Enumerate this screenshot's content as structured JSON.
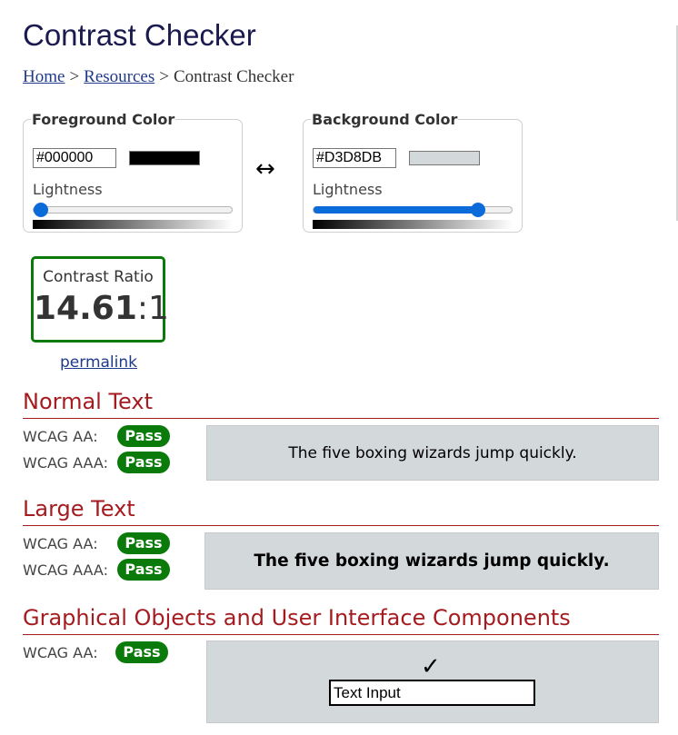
{
  "page_title": "Contrast Checker",
  "breadcrumb": {
    "home": "Home",
    "sep1": ">",
    "resources": "Resources",
    "sep2": ">",
    "current": "Contrast Checker"
  },
  "foreground": {
    "legend": "Foreground Color",
    "hex": "#000000",
    "swatch_color": "#000000",
    "lightness_label": "Lightness",
    "lightness_level": 0.0
  },
  "swap_icon": "↔",
  "background": {
    "legend": "Background Color",
    "hex": "#D3D8DB",
    "swatch_color": "#D3D8DB",
    "lightness_label": "Lightness",
    "lightness_level": 0.85
  },
  "contrast": {
    "label": "Contrast Ratio",
    "value": "14.61",
    "suffix": ":1",
    "permalink": "permalink"
  },
  "normal_text": {
    "title": "Normal Text",
    "aa_label": "WCAG AA:",
    "aa_result": "Pass",
    "aaa_label": "WCAG AAA:",
    "aaa_result": "Pass",
    "sample": "The five boxing wizards jump quickly."
  },
  "large_text": {
    "title": "Large Text",
    "aa_label": "WCAG AA:",
    "aa_result": "Pass",
    "aaa_label": "WCAG AAA:",
    "aaa_result": "Pass",
    "sample": "The five boxing wizards jump quickly."
  },
  "graphical": {
    "title": "Graphical Objects and User Interface Components",
    "aa_label": "WCAG AA:",
    "aa_result": "Pass",
    "check_icon": "✓",
    "input_value": "Text Input"
  },
  "colors": {
    "pass_green": "#0A7A0A",
    "section_red": "#A51C20",
    "link_blue": "#1F3A8A",
    "slider_blue": "#0B6BD9"
  }
}
